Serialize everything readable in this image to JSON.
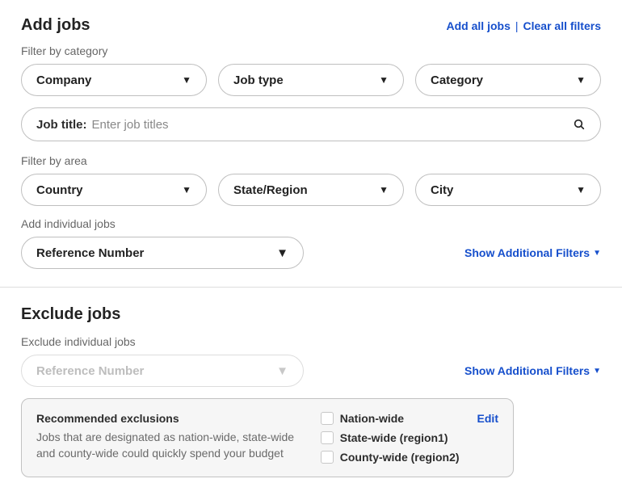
{
  "add": {
    "title": "Add jobs",
    "header_links": {
      "add_all": "Add all jobs",
      "clear_all": "Clear all filters"
    },
    "category": {
      "label": "Filter by category",
      "company": "Company",
      "job_type": "Job type",
      "category": "Category"
    },
    "job_title": {
      "prefix": "Job title:",
      "placeholder": "Enter job titles"
    },
    "area": {
      "label": "Filter by area",
      "country": "Country",
      "state": "State/Region",
      "city": "City"
    },
    "individual": {
      "label": "Add individual jobs",
      "ref": "Reference Number"
    },
    "show_more": "Show Additional Filters"
  },
  "exclude": {
    "title": "Exclude jobs",
    "individual_label": "Exclude individual jobs",
    "ref": "Reference Number",
    "show_more": "Show Additional Filters",
    "rec": {
      "title": "Recommended exclusions",
      "desc": "Jobs that are designated as nation-wide, state-wide and county-wide could quickly spend your budget",
      "options": {
        "nation": "Nation-wide",
        "state": "State-wide (region1)",
        "county": "County-wide (region2)"
      },
      "edit": "Edit"
    }
  }
}
